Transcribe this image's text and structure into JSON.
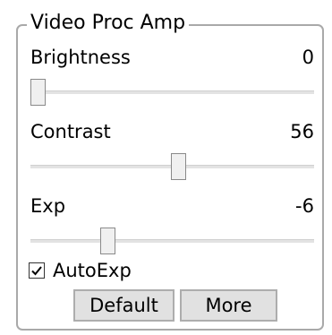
{
  "group": {
    "title": "Video Proc Amp"
  },
  "brightness": {
    "label": "Brightness",
    "value": "0",
    "slider_position": 0.0
  },
  "contrast": {
    "label": "Contrast",
    "value": "56",
    "slider_position": 0.52
  },
  "exp": {
    "label": "Exp",
    "value": "-6",
    "slider_position": 0.26
  },
  "autoexp": {
    "label": "AutoExp",
    "checked": true
  },
  "buttons": {
    "default_label": "Default",
    "more_label": "More"
  }
}
